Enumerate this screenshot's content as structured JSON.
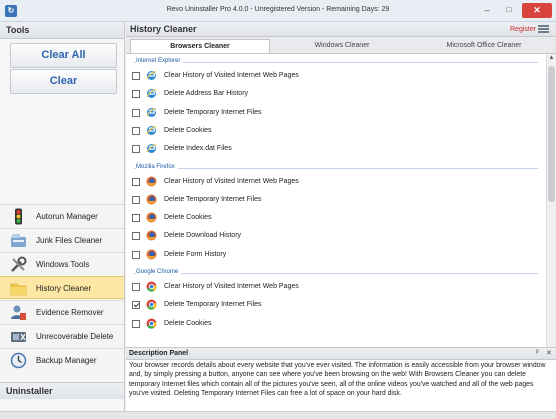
{
  "window": {
    "title": "Revo Uninstaller Pro 4.0.0 - Unregistered Version - Remaining Days: 29",
    "minimize": "–",
    "maximize": "□",
    "close": "✕"
  },
  "left": {
    "header": "Tools",
    "clear_all": "Clear All",
    "clear": "Clear",
    "nav": [
      {
        "label": "Autorun Manager",
        "icon": "traffic-light-icon"
      },
      {
        "label": "Junk Files Cleaner",
        "icon": "junk-files-icon"
      },
      {
        "label": "Windows Tools",
        "icon": "tools-icon"
      },
      {
        "label": "History Cleaner",
        "icon": "history-folder-icon",
        "active": true
      },
      {
        "label": "Evidence Remover",
        "icon": "evidence-remover-icon"
      },
      {
        "label": "Unrecoverable Delete",
        "icon": "unrecoverable-delete-icon"
      },
      {
        "label": "Backup Manager",
        "icon": "backup-clock-icon"
      }
    ],
    "footer": "Uninstaller"
  },
  "main": {
    "header": "History Cleaner",
    "register": "Register",
    "tabs": [
      "Browsers Cleaner",
      "Windows Cleaner",
      "Microsoft Office Cleaner"
    ],
    "groups": [
      {
        "name": "Internet Explorer",
        "icon": "internet-explorer-icon",
        "items": [
          {
            "label": "Clear History of Visited Internet Web Pages",
            "checked": false
          },
          {
            "label": "Delete Address Bar History",
            "checked": false
          },
          {
            "label": "Delete Temporary Internet Files",
            "checked": false
          },
          {
            "label": "Delete Cookies",
            "checked": false
          },
          {
            "label": "Delete Index.dat Files",
            "checked": false
          }
        ]
      },
      {
        "name": "Mozilla Firefox",
        "icon": "firefox-icon",
        "items": [
          {
            "label": "Clear History of Visited Internet Web Pages",
            "checked": false
          },
          {
            "label": "Delete Temporary Internet Files",
            "checked": false
          },
          {
            "label": "Delete Cookies",
            "checked": false
          },
          {
            "label": "Delete Download History",
            "checked": false
          },
          {
            "label": "Delete Form History",
            "checked": false
          }
        ]
      },
      {
        "name": "Google Chrome",
        "icon": "chrome-icon",
        "items": [
          {
            "label": "Clear History of Visited Internet Web Pages",
            "checked": false
          },
          {
            "label": "Delete Temporary Internet Files",
            "checked": true
          },
          {
            "label": "Delete Cookies",
            "checked": false
          }
        ]
      }
    ],
    "description_title": "Description Panel",
    "description_text": "Your browser records details about every website that you've ever visited. The information is easily accessible from your browser window and, by simply pressing a button, anyone can see where you've been browsing on the web! With Browsers Cleaner you can delete temporary Internet files which contain all of the pictures you've seen, all of the online videos you've watched and all of the web pages you've visited. Deleting Temporary Internet Files can free a lot of space on your hard disk."
  }
}
